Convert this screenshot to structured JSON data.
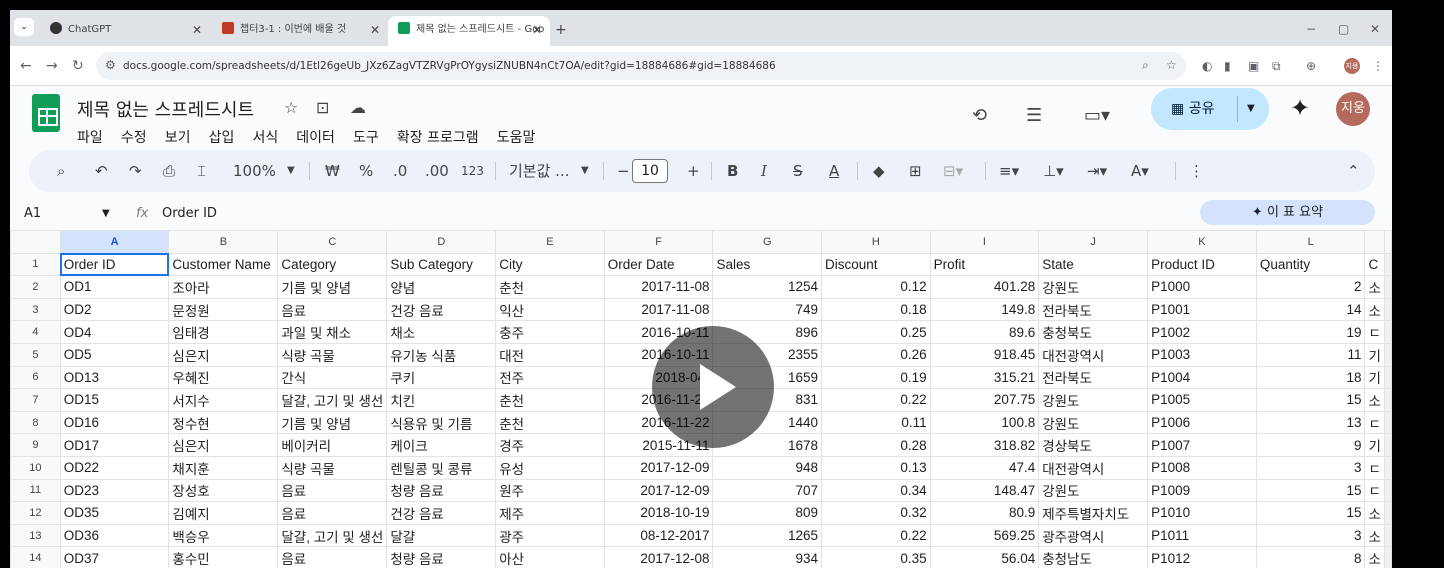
{
  "tabs": [
    {
      "title": "ChatGPT",
      "active": false
    },
    {
      "title": "챕터3-1 : 이번에 배울 것",
      "active": false
    },
    {
      "title": "제목 없는 스프레드시트 - Goo",
      "active": true
    }
  ],
  "address": {
    "url": "docs.google.com/spreadsheets/d/1Etl26geUb_JXz6ZagVTZRVgPrOYgysiZNUBN4nCt7OA/edit?gid=18884686#gid=18884686"
  },
  "profile_initials": "지용",
  "doc": {
    "title": "제목 없는 스프레드시트",
    "menu": [
      "파일",
      "수정",
      "보기",
      "삽입",
      "서식",
      "데이터",
      "도구",
      "확장 프로그램",
      "도움말"
    ],
    "share_label": "공유",
    "avatar": "지웅"
  },
  "toolbar": {
    "zoom": "100%",
    "currency": "₩",
    "percent": "%",
    "dec_decrease": ".0",
    "dec_increase": ".00",
    "format_123": "123",
    "font": "기본값 ...",
    "font_size": "10"
  },
  "formula_bar": {
    "cell": "A1",
    "fx": "fx",
    "value": "Order ID",
    "summary": "✦ 이 표 요약"
  },
  "grid": {
    "col_letters": [
      "A",
      "B",
      "C",
      "D",
      "E",
      "F",
      "G",
      "H",
      "I",
      "J",
      "K",
      "L"
    ],
    "rows": [
      [
        "Order ID",
        "Customer Name",
        "Category",
        "Sub Category",
        "City",
        "Order Date",
        "Sales",
        "Discount",
        "Profit",
        "State",
        "Product ID",
        "Quantity",
        "C"
      ],
      [
        "OD1",
        "조아라",
        "기름 및 양념",
        "양념",
        "춘천",
        "2017-11-08",
        "1254",
        "0.12",
        "401.28",
        "강원도",
        "P1000",
        "2",
        "소"
      ],
      [
        "OD2",
        "문정원",
        "음료",
        "건강 음료",
        "익산",
        "2017-11-08",
        "749",
        "0.18",
        "149.8",
        "전라북도",
        "P1001",
        "14",
        "소"
      ],
      [
        "OD4",
        "임태경",
        "과일 및 채소",
        "채소",
        "충주",
        "2016-10-11",
        "896",
        "0.25",
        "89.6",
        "충청북도",
        "P1002",
        "19",
        "ㄷ"
      ],
      [
        "OD5",
        "심은지",
        "식량 곡물",
        "유기농 식품",
        "대전",
        "2016-10-11",
        "2355",
        "0.26",
        "918.45",
        "대전광역시",
        "P1003",
        "11",
        "기"
      ],
      [
        "OD13",
        "우혜진",
        "간식",
        "쿠키",
        "전주",
        "2018-04-",
        "1659",
        "0.19",
        "315.21",
        "전라북도",
        "P1004",
        "18",
        "기"
      ],
      [
        "OD15",
        "서지수",
        "달걀, 고기 및 생선",
        "치킨",
        "춘천",
        "2016-11-22",
        "831",
        "0.22",
        "207.75",
        "강원도",
        "P1005",
        "15",
        "소"
      ],
      [
        "OD16",
        "정수현",
        "기름 및 양념",
        "식용유 및 기름",
        "춘천",
        "2016-11-22",
        "1440",
        "0.11",
        "100.8",
        "강원도",
        "P1006",
        "13",
        "ㄷ"
      ],
      [
        "OD17",
        "심은지",
        "베이커리",
        "케이크",
        "경주",
        "2015-11-11",
        "1678",
        "0.28",
        "318.82",
        "경상북도",
        "P1007",
        "9",
        "기"
      ],
      [
        "OD22",
        "채지훈",
        "식량 곡물",
        "렌틸콩 및 콩류",
        "유성",
        "2017-12-09",
        "948",
        "0.13",
        "47.4",
        "대전광역시",
        "P1008",
        "3",
        "ㄷ"
      ],
      [
        "OD23",
        "장성호",
        "음료",
        "청량 음료",
        "원주",
        "2017-12-09",
        "707",
        "0.34",
        "148.47",
        "강원도",
        "P1009",
        "15",
        "ㄷ"
      ],
      [
        "OD35",
        "김예지",
        "음료",
        "건강 음료",
        "제주",
        "2018-10-19",
        "809",
        "0.32",
        "80.9",
        "제주특별자치도",
        "P1010",
        "15",
        "소"
      ],
      [
        "OD36",
        "백승우",
        "달걀, 고기 및 생선",
        "달걀",
        "광주",
        "08-12-2017",
        "1265",
        "0.22",
        "569.25",
        "광주광역시",
        "P1011",
        "3",
        "소"
      ],
      [
        "OD37",
        "홍수민",
        "음료",
        "청량 음료",
        "아산",
        "2017-12-08",
        "934",
        "0.35",
        "56.04",
        "충청남도",
        "P1012",
        "8",
        "소"
      ]
    ]
  }
}
